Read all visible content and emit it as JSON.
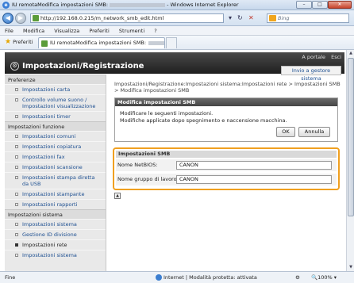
{
  "window": {
    "title": "IU remotaModifica impostazioni SMB:",
    "title_suffix": "- Windows Internet Explorer",
    "min_glyph": "–",
    "max_glyph": "□",
    "close_glyph": "✕"
  },
  "addressbar": {
    "url": "http://192.168.0.215/m_network_smb_edit.html",
    "search_placeholder": "Bing",
    "refresh_glyph": "↻",
    "stop_glyph": "✕"
  },
  "menu": [
    "File",
    "Modifica",
    "Visualizza",
    "Preferiti",
    "Strumenti",
    "?"
  ],
  "favorites": {
    "label": "Preferiti",
    "tab_title": "IU remotaModifica impostazioni SMB:"
  },
  "header": {
    "links": [
      "A portale",
      "Esci"
    ],
    "title": "Impostazioni/Registrazione",
    "top_link": "Invio a gestore sistema"
  },
  "sidebar": {
    "sections": [
      {
        "title": "Preferenze",
        "items": [
          "Impostazioni carta",
          "Controllo volume suono / Impostazioni visualizzazione",
          "Impostazioni timer"
        ]
      },
      {
        "title": "Impostazioni funzione",
        "items": [
          "Impostazioni comuni",
          "Impostazioni copiatura",
          "Impostazioni fax",
          "Impostazioni scansione",
          "Impostazioni stampa diretta da USB",
          "Impostazioni stampante",
          "Impostazioni rapporti"
        ]
      },
      {
        "title": "Impostazioni sistema",
        "items": [
          "Impostazioni sistema",
          "Gestione ID divisione",
          "Impostazioni rete",
          "Impostazioni sistema"
        ]
      }
    ]
  },
  "main": {
    "breadcrumb": "Impostazioni/Registrazione:Impostazioni sistema:Impostazioni rete > Impostazioni SMB > Modifica impostazioni SMB",
    "dialog": {
      "title": "Modifica impostazioni SMB",
      "line1": "Modificare le seguenti impostazioni.",
      "line2": "Modifiche applicate dopo spegnimento e naccensione macchina.",
      "ok_label": "OK",
      "cancel_label": "Annulla"
    },
    "smb": {
      "title": "Impostazioni SMB",
      "netbios_label": "Nome NetBIOS:",
      "netbios_value": "CANON",
      "workgroup_label": "Nome gruppo di lavoro:",
      "workgroup_value": "CANON"
    },
    "to_top_glyph": "▲"
  },
  "statusbar": {
    "left": "Fine",
    "zone": "Internet | Modalità protetta: attivata",
    "zoom": "100%"
  }
}
